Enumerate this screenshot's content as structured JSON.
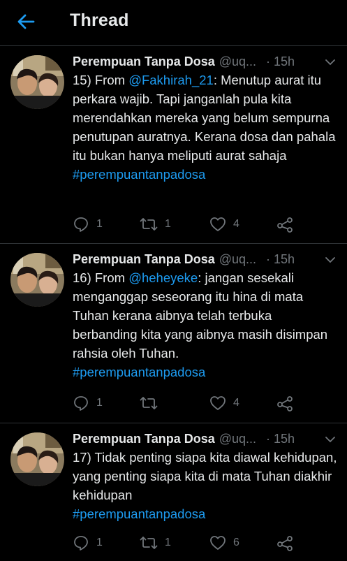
{
  "header": {
    "title": "Thread",
    "back_icon": "arrow-left-icon"
  },
  "colors": {
    "background": "#000000",
    "accent": "#1d9bf0",
    "muted": "#71767b",
    "text": "#e7e9ea"
  },
  "tweets": [
    {
      "name": "Perempuan Tanpa Dosa",
      "handle": "@uq...",
      "dot": "·",
      "time": "15h",
      "text_before": "15) From ",
      "mention": "@Fakhirah_21",
      "text_after": ": Menutup aurat itu perkara wajib. Tapi janganlah pula kita merendahkan mereka yang belum sempurna penutupan auratnya. Kerana dosa dan pahala itu bukan hanya meliputi aurat sahaja",
      "hashtag": "#perempuantanpadosa",
      "replies": "1",
      "retweets": "1",
      "likes": "4"
    },
    {
      "name": "Perempuan Tanpa Dosa",
      "handle": "@uq...",
      "dot": "·",
      "time": "15h",
      "text_before": "16) From ",
      "mention": "@heheyeke",
      "text_after": ": jangan sesekali menganggap seseorang itu hina di mata Tuhan kerana aibnya telah terbuka berbanding kita yang aibnya masih disimpan rahsia oleh Tuhan.",
      "hashtag": "#perempuantanpadosa",
      "replies": "1",
      "retweets": "",
      "likes": "4"
    },
    {
      "name": "Perempuan Tanpa Dosa",
      "handle": "@uq...",
      "dot": "·",
      "time": "15h",
      "text_before": "17) Tidak penting siapa kita diawal kehidupan, yang penting siapa kita di mata Tuhan diakhir kehidupan",
      "mention": "",
      "text_after": "",
      "hashtag": "#perempuantanpadosa",
      "replies": "1",
      "retweets": "1",
      "likes": "6"
    }
  ]
}
